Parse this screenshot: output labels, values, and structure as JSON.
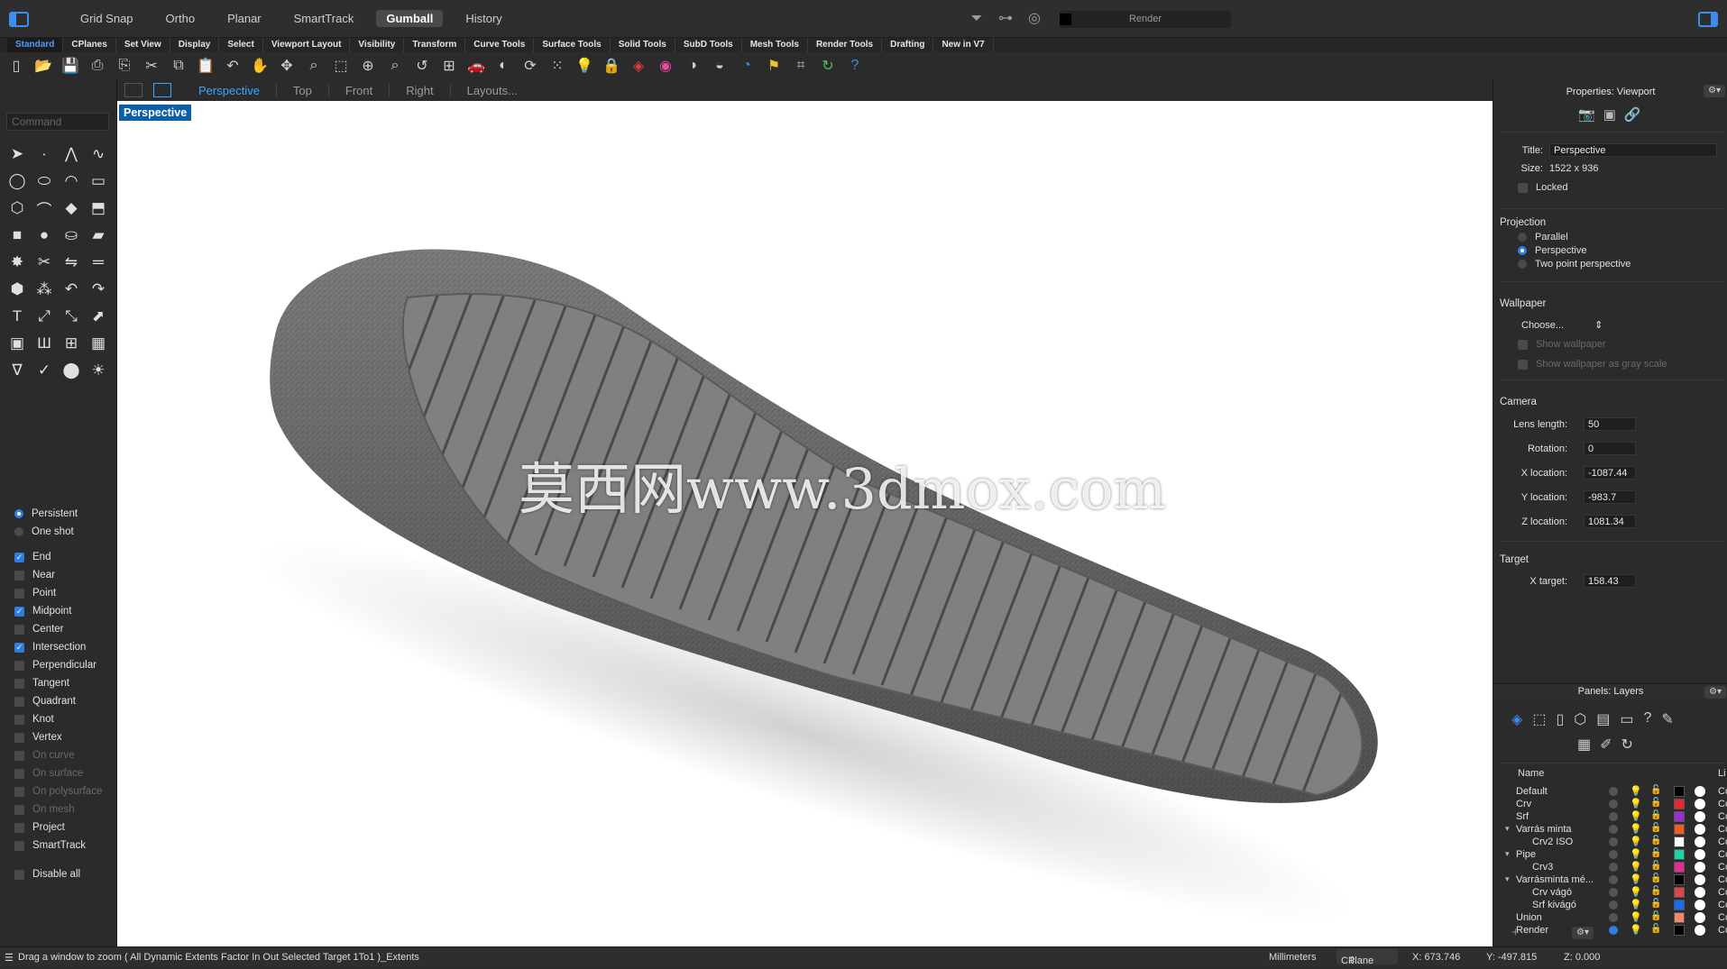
{
  "titlebar": {
    "modes": [
      {
        "label": "Grid Snap",
        "active": false
      },
      {
        "label": "Ortho",
        "active": false
      },
      {
        "label": "Planar",
        "active": false
      },
      {
        "label": "SmartTrack",
        "active": false
      },
      {
        "label": "Gumball",
        "active": true
      },
      {
        "label": "History",
        "active": false
      }
    ],
    "display_mode": "Render"
  },
  "tabs": [
    "Standard",
    "CPlanes",
    "Set View",
    "Display",
    "Select",
    "Viewport Layout",
    "Visibility",
    "Transform",
    "Curve Tools",
    "Surface Tools",
    "Solid Tools",
    "SubD Tools",
    "Mesh Tools",
    "Render Tools",
    "Drafting",
    "New in V7"
  ],
  "active_tab": "Standard",
  "toolbar_icons": [
    "new-icon",
    "open-icon",
    "save-icon",
    "print-icon",
    "import-icon",
    "cut-icon",
    "copy-icon",
    "paste-icon",
    "undo-icon",
    "pan-hand-icon",
    "rotate-view-icon",
    "zoom-icon",
    "zoom-window-icon",
    "zoom-extents-icon",
    "zoom-selected-icon",
    "undo-view-icon",
    "four-viewports-icon",
    "car-render-icon",
    "shaded-icon",
    "rotate-icon",
    "point-cloud-icon",
    "light-icon",
    "lock-icon",
    "material-icon",
    "color-wheel-icon",
    "sphere-icon",
    "render-sphere-icon",
    "environment-icon",
    "pointcloud-icon",
    "grid-icon",
    "refresh-icon",
    "help-icon"
  ],
  "viewport_tabs": {
    "items": [
      "Perspective",
      "Top",
      "Front",
      "Right",
      "Layouts..."
    ],
    "active": "Perspective"
  },
  "command": {
    "placeholder": "Command"
  },
  "viewport": {
    "label": "Perspective",
    "watermark": "莫西网www.3dmox.com"
  },
  "osnaps": {
    "mode_persistent": "Persistent",
    "mode_oneshot": "One shot",
    "items": [
      {
        "label": "End",
        "checked": true,
        "enabled": true
      },
      {
        "label": "Near",
        "checked": false,
        "enabled": true
      },
      {
        "label": "Point",
        "checked": false,
        "enabled": true
      },
      {
        "label": "Midpoint",
        "checked": true,
        "enabled": true
      },
      {
        "label": "Center",
        "checked": false,
        "enabled": true
      },
      {
        "label": "Intersection",
        "checked": true,
        "enabled": true
      },
      {
        "label": "Perpendicular",
        "checked": false,
        "enabled": true
      },
      {
        "label": "Tangent",
        "checked": false,
        "enabled": true
      },
      {
        "label": "Quadrant",
        "checked": false,
        "enabled": true
      },
      {
        "label": "Knot",
        "checked": false,
        "enabled": true
      },
      {
        "label": "Vertex",
        "checked": false,
        "enabled": true
      },
      {
        "label": "On curve",
        "checked": false,
        "enabled": false
      },
      {
        "label": "On surface",
        "checked": false,
        "enabled": false
      },
      {
        "label": "On polysurface",
        "checked": false,
        "enabled": false
      },
      {
        "label": "On mesh",
        "checked": false,
        "enabled": false
      },
      {
        "label": "Project",
        "checked": false,
        "enabled": true
      },
      {
        "label": "SmartTrack",
        "checked": false,
        "enabled": true
      }
    ],
    "disable_all": "Disable all"
  },
  "properties": {
    "title": "Properties: Viewport",
    "title_label": "Title:",
    "title_value": "Perspective",
    "size_label": "Size:",
    "size_value": "1522 x 936",
    "locked_label": "Locked",
    "projection_header": "Projection",
    "projection_options": [
      "Parallel",
      "Perspective",
      "Two point perspective"
    ],
    "projection_selected": "Perspective",
    "wallpaper_header": "Wallpaper",
    "wallpaper_choose": "Choose...",
    "show_wallpaper": "Show wallpaper",
    "show_wallpaper_gray": "Show wallpaper as gray scale",
    "camera_header": "Camera",
    "lens_label": "Lens length:",
    "lens_value": "50",
    "rotation_label": "Rotation:",
    "rotation_value": "0",
    "xloc_label": "X location:",
    "xloc_value": "-1087.44",
    "yloc_label": "Y location:",
    "yloc_value": "-983.7",
    "zloc_label": "Z location:",
    "zloc_value": "1081.34",
    "target_header": "Target",
    "xtarget_label": "X target:",
    "xtarget_value": "158.43"
  },
  "layers_panel": {
    "title": "Panels: Layers",
    "col_name": "Name",
    "col_li": "Li",
    "rows": [
      {
        "name": "Default",
        "indent": 0,
        "chevron": "",
        "color": "#000000",
        "current": false,
        "co": "Co"
      },
      {
        "name": "Crv",
        "indent": 0,
        "chevron": "",
        "color": "#e8262b",
        "current": false,
        "co": "Co"
      },
      {
        "name": "Srf",
        "indent": 0,
        "chevron": "",
        "color": "#9a2fd8",
        "current": false,
        "co": "Co"
      },
      {
        "name": "Varrás minta",
        "indent": 0,
        "chevron": "⌄",
        "color": "#f05a24",
        "current": false,
        "co": "Co"
      },
      {
        "name": "Crv2 ISO",
        "indent": 1,
        "chevron": "",
        "color": "#ffffff",
        "current": false,
        "co": "Co"
      },
      {
        "name": "Pipe",
        "indent": 0,
        "chevron": "⌄",
        "color": "#19d6a0",
        "current": false,
        "co": "Co"
      },
      {
        "name": "Crv3",
        "indent": 1,
        "chevron": "",
        "color": "#e82b8c",
        "current": false,
        "co": "Co"
      },
      {
        "name": "Varrásminta mé...",
        "indent": 0,
        "chevron": "⌄",
        "color": "#000000",
        "current": false,
        "co": "Co"
      },
      {
        "name": "Crv vágó",
        "indent": 1,
        "chevron": "",
        "color": "#e0454a",
        "current": false,
        "co": "Co"
      },
      {
        "name": "Srf kivágó",
        "indent": 1,
        "chevron": "",
        "color": "#1b6bf0",
        "current": false,
        "co": "Co"
      },
      {
        "name": "Union",
        "indent": 0,
        "chevron": "",
        "color": "#f08a6a",
        "current": false,
        "co": "Co"
      },
      {
        "name": "Render",
        "indent": 0,
        "chevron": "",
        "color": "#000000",
        "current": true,
        "co": "Co"
      }
    ]
  },
  "status": {
    "prompt": "Drag a window to zoom ( All Dynamic Extents Factor In Out Selected Target 1To1 )_Extents",
    "units": "Millimeters",
    "cplane": "CPlane",
    "x": "X: 673.746",
    "y": "Y: -497.815",
    "z": "Z: 0.000"
  }
}
